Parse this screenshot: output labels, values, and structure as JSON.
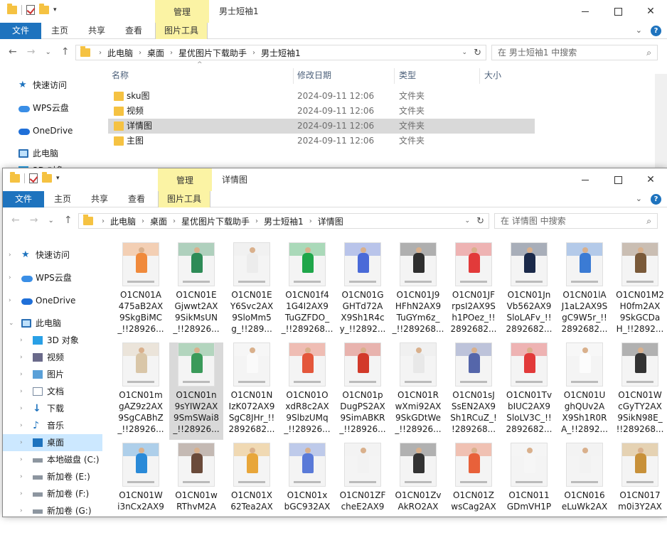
{
  "win1": {
    "title": "男士短袖1",
    "manage": "管理",
    "tabs": [
      "文件",
      "主页",
      "共享",
      "查看",
      "图片工具"
    ],
    "path": [
      "此电脑",
      "桌面",
      "星优图片下载助手",
      "男士短袖1"
    ],
    "search_placeholder": "在 男士短袖1 中搜索",
    "sidebar": [
      {
        "label": "快速访问",
        "icon": "star-icon"
      },
      {
        "label": "WPS云盘",
        "icon": "cloud-icon"
      },
      {
        "label": "OneDrive",
        "icon": "onedrive-icon"
      },
      {
        "label": "此电脑",
        "icon": "pc-icon"
      }
    ],
    "columns": [
      "名称",
      "修改日期",
      "类型",
      "大小"
    ],
    "files": [
      {
        "name": "sku图",
        "date": "2024-09-11 12:06",
        "type": "文件夹"
      },
      {
        "name": "视频",
        "date": "2024-09-11 12:06",
        "type": "文件夹"
      },
      {
        "name": "详情图",
        "date": "2024-09-11 12:06",
        "type": "文件夹",
        "selected": true
      },
      {
        "name": "主图",
        "date": "2024-09-11 12:06",
        "type": "文件夹"
      }
    ],
    "partial_item": "3D 对象"
  },
  "win2": {
    "title": "详情图",
    "manage": "管理",
    "tabs": [
      "文件",
      "主页",
      "共享",
      "查看",
      "图片工具"
    ],
    "path": [
      "此电脑",
      "桌面",
      "星优图片下载助手",
      "男士短袖1",
      "详情图"
    ],
    "search_placeholder": "在 详情图 中搜索",
    "sidebar": [
      {
        "label": "快速访问",
        "icon": "star-icon",
        "arrow": "›"
      },
      {
        "label": "WPS云盘",
        "icon": "cloud-icon",
        "arrow": "›"
      },
      {
        "label": "OneDrive",
        "icon": "onedrive-icon",
        "arrow": "›"
      },
      {
        "label": "此电脑",
        "icon": "pc-icon",
        "arrow": "⌄"
      },
      {
        "label": "3D 对象",
        "icon": "cube-icon",
        "arrow": "›"
      },
      {
        "label": "视频",
        "icon": "video-icon",
        "arrow": "›"
      },
      {
        "label": "图片",
        "icon": "picture-icon",
        "arrow": "›"
      },
      {
        "label": "文档",
        "icon": "document-icon",
        "arrow": "›"
      },
      {
        "label": "下载",
        "icon": "download-icon",
        "arrow": "›"
      },
      {
        "label": "音乐",
        "icon": "music-icon",
        "arrow": "›"
      },
      {
        "label": "桌面",
        "icon": "desktop-icon",
        "arrow": "›",
        "selected": true
      },
      {
        "label": "本地磁盘 (C:)",
        "icon": "drive-icon",
        "arrow": "›"
      },
      {
        "label": "新加卷 (E:)",
        "icon": "drive-icon",
        "arrow": "›"
      },
      {
        "label": "新加卷 (F:)",
        "icon": "drive-icon",
        "arrow": "›"
      },
      {
        "label": "新加卷 (G:)",
        "icon": "drive-icon",
        "arrow": "›"
      }
    ],
    "files": [
      {
        "name": "O1CN01A\n475aB2AX\n9SkgBiMC\n_!!28926...",
        "c": "#f08a3c"
      },
      {
        "name": "O1CN01E\nGjwwt2AX\n9SikMsUN\n_!!28926...",
        "c": "#2e8b57"
      },
      {
        "name": "O1CN01E\nY6Svc2AX\n9SloMm5\ng_!!289...",
        "c": "#ececec"
      },
      {
        "name": "O1CN01f4\n1G4I2AX9\nTuGZFDO_\n_!!289268...",
        "c": "#1fa64a"
      },
      {
        "name": "O1CN01G\nGHTd72A\nX9Sh1R4c\ny_!!2892...",
        "c": "#4a6ad8"
      },
      {
        "name": "O1CN01J9\nHFhN2AX9\nTuGYm6z_\n_!!289268...",
        "c": "#2f2f2f"
      },
      {
        "name": "O1CN01JF\nrpsI2AX9S\nh1POez_!!\n2892682...",
        "c": "#e23a3a"
      },
      {
        "name": "O1CN01Jn\nVb562AX9\nSloLAFv_!!\n2892682...",
        "c": "#1b2a4a"
      },
      {
        "name": "O1CN01lA\nJ1aL2AX9S\ngC9W5r_!!\n2892682...",
        "c": "#3b7bd4"
      },
      {
        "name": "O1CN01M2\nH0fm2AX\n9SkGCDa\nH_!!2892...",
        "c": "#7a5a3a"
      },
      {
        "name": "O1CN01m\ngAZ9z2AX\n9SgCABhZ\n_!!28926...",
        "c": "#d9c6a8"
      },
      {
        "name": "O1CN01n\n9sYIW2AX\n9SmSWai8\n_!!28926...",
        "c": "#3a9a5a",
        "selected": true
      },
      {
        "name": "O1CN01N\nIzK072AX9\nSgC8JHr_!!\n2892682...",
        "c": "#fafafa"
      },
      {
        "name": "O1CN01O\nxdR8c2AX\n9SlbzUMq\n_!!28926...",
        "c": "#e4573b"
      },
      {
        "name": "O1CN01p\nDugPS2AX\n9SimABKR\n_!!28926...",
        "c": "#d23a2a"
      },
      {
        "name": "O1CN01R\nwXmi92AX\n9SkGDtWe\n_!!28926...",
        "c": "#e8e8e8"
      },
      {
        "name": "O1CN01sJ\nSsEN2AX9\nSh1RCuZ_!\n!289268...",
        "c": "#5566aa"
      },
      {
        "name": "O1CN01Tv\nbIUC2AX9\nSloLV3C_!!\n2892682...",
        "c": "#e23a3a"
      },
      {
        "name": "O1CN01U\nghQUv2A\nX9Sh1R0R\nA_!!2892...",
        "c": "#fcfcfc"
      },
      {
        "name": "O1CN01W\ncGyTY2AX\n9SikN98E_\n!!289268...",
        "c": "#333333"
      },
      {
        "name": "O1CN01W\ni3nCx2AX9",
        "c": "#2a8ad8"
      },
      {
        "name": "O1CN01w\nRThvM2A",
        "c": "#6a4a3a"
      },
      {
        "name": "O1CN01X\n62Tea2AX",
        "c": "#e8a63a"
      },
      {
        "name": "O1CN01x\nbGC932AX",
        "c": "#5a7ad8"
      },
      {
        "name": "O1CN01ZF\ncheE2AX9",
        "c": "#f2f2f2"
      },
      {
        "name": "O1CN01Zv\nAkRO2AX",
        "c": "#333333"
      },
      {
        "name": "O1CN01Z\nwsCag2AX",
        "c": "#e8613a"
      },
      {
        "name": "O1CN011\nGDmVH1P",
        "c": "#f6f6f6"
      },
      {
        "name": "O1CN016\neLuWk2AX",
        "c": "#f2f2f2"
      },
      {
        "name": "O1CN017\nm0i3Y2AX",
        "c": "#c8913a"
      }
    ]
  }
}
